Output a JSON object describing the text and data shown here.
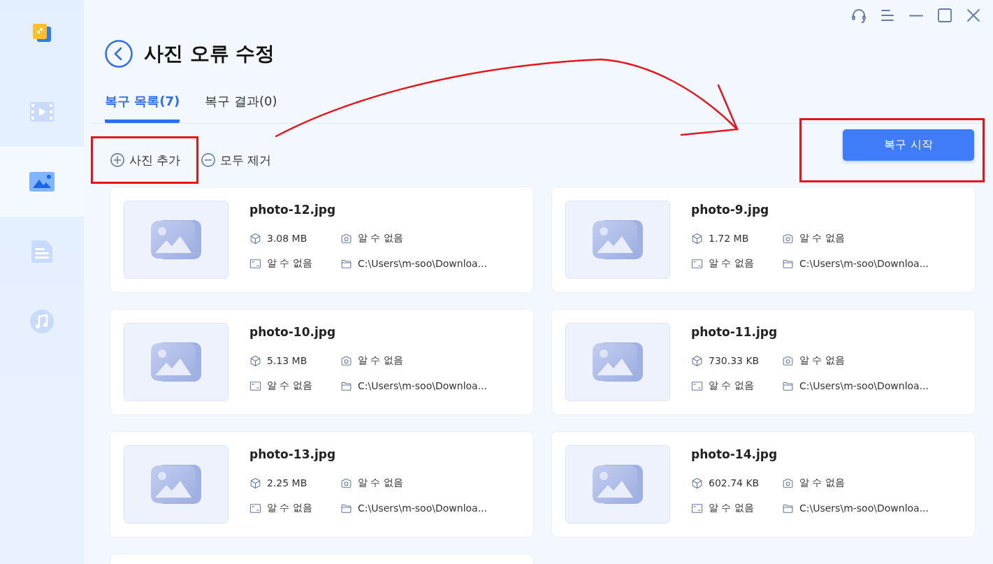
{
  "sidebar": {
    "items": [
      {
        "kind": "video",
        "selected": false
      },
      {
        "kind": "photo",
        "selected": true
      },
      {
        "kind": "document",
        "selected": false
      },
      {
        "kind": "music",
        "selected": false
      }
    ]
  },
  "header": {
    "title": "사진 오류 수정"
  },
  "tabs": [
    {
      "label": "복구 목록(7)",
      "selected": true
    },
    {
      "label": "복구 결과(0)",
      "selected": false
    }
  ],
  "toolbar": {
    "add_button": {
      "label": "사진 추가",
      "highlighted": true
    },
    "remove_all_button": {
      "label": "모두 제거",
      "highlighted": false
    },
    "start_button": {
      "label": "복구 시작",
      "highlighted": true
    }
  },
  "annotation_arrow": true,
  "photos": [
    {
      "kind": "card",
      "name": "photo-12.jpg",
      "size": "3.08 MB",
      "camera": "알 수 없음",
      "resolution": "알 수 없음",
      "path": "C:\\Users\\m-soo\\Downloa..."
    },
    {
      "kind": "card",
      "name": "photo-9.jpg",
      "size": "1.72 MB",
      "camera": "알 수 없음",
      "resolution": "알 수 없음",
      "path": "C:\\Users\\m-soo\\Downloa..."
    },
    {
      "kind": "card",
      "name": "photo-10.jpg",
      "size": "5.13 MB",
      "camera": "알 수 없음",
      "resolution": "알 수 없음",
      "path": "C:\\Users\\m-soo\\Downloa..."
    },
    {
      "kind": "card",
      "name": "photo-11.jpg",
      "size": "730.33 KB",
      "camera": "알 수 없음",
      "resolution": "알 수 없음",
      "path": "C:\\Users\\m-soo\\Downloa..."
    },
    {
      "kind": "card",
      "name": "photo-13.jpg",
      "size": "2.25 MB",
      "camera": "알 수 없음",
      "resolution": "알 수 없음",
      "path": "C:\\Users\\m-soo\\Downloa..."
    },
    {
      "kind": "card",
      "name": "photo-14.jpg",
      "size": "602.74 KB",
      "camera": "알 수 없음",
      "resolution": "알 수 없음",
      "path": "C:\\Users\\m-soo\\Downloa..."
    },
    {
      "kind": "partial"
    }
  ]
}
